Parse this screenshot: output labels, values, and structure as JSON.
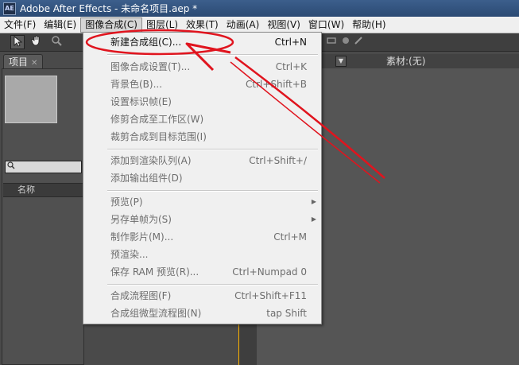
{
  "window": {
    "title": "Adobe After Effects - 未命名项目.aep *",
    "logo_text": "AE"
  },
  "menubar": [
    {
      "label": "文件(F)"
    },
    {
      "label": "编辑(E)"
    },
    {
      "label": "图像合成(C)",
      "active": true
    },
    {
      "label": "图层(L)"
    },
    {
      "label": "效果(T)"
    },
    {
      "label": "动画(A)"
    },
    {
      "label": "视图(V)"
    },
    {
      "label": "窗口(W)"
    },
    {
      "label": "帮助(H)"
    }
  ],
  "project_panel": {
    "tab_label": "项目",
    "column_name": "名称",
    "search_icon": "search-icon"
  },
  "footage_panel": {
    "tab_label": "素材:(无)"
  },
  "dropdown": {
    "items": [
      {
        "label": "新建合成组(C)...",
        "shortcut": "Ctrl+N",
        "enabled": true
      },
      {
        "label": "图像合成设置(T)...",
        "shortcut": "Ctrl+K",
        "enabled": false
      },
      {
        "label": "背景色(B)...",
        "shortcut": "Ctrl+Shift+B",
        "enabled": false
      },
      {
        "label": "设置标识帧(E)",
        "shortcut": "",
        "enabled": false
      },
      {
        "label": "修剪合成至工作区(W)",
        "shortcut": "",
        "enabled": false
      },
      {
        "label": "裁剪合成到目标范围(I)",
        "shortcut": "",
        "enabled": false
      },
      {
        "label": "添加到渲染队列(A)",
        "shortcut": "Ctrl+Shift+/",
        "enabled": false
      },
      {
        "label": "添加输出组件(D)",
        "shortcut": "",
        "enabled": false
      },
      {
        "label": "预览(P)",
        "shortcut": "",
        "enabled": false,
        "submenu": true
      },
      {
        "label": "另存单帧为(S)",
        "shortcut": "",
        "enabled": false,
        "submenu": true
      },
      {
        "label": "制作影片(M)...",
        "shortcut": "Ctrl+M",
        "enabled": false
      },
      {
        "label": "预渲染...",
        "shortcut": "",
        "enabled": false
      },
      {
        "label": "保存 RAM 预览(R)...",
        "shortcut": "Ctrl+Numpad 0",
        "enabled": false
      },
      {
        "label": "合成流程图(F)",
        "shortcut": "Ctrl+Shift+F11",
        "enabled": false
      },
      {
        "label": "合成组微型流程图(N)",
        "shortcut": "tap Shift",
        "enabled": false
      }
    ]
  },
  "colors": {
    "annotation": "#e0141e",
    "panel_highlight": "#ffb400"
  }
}
